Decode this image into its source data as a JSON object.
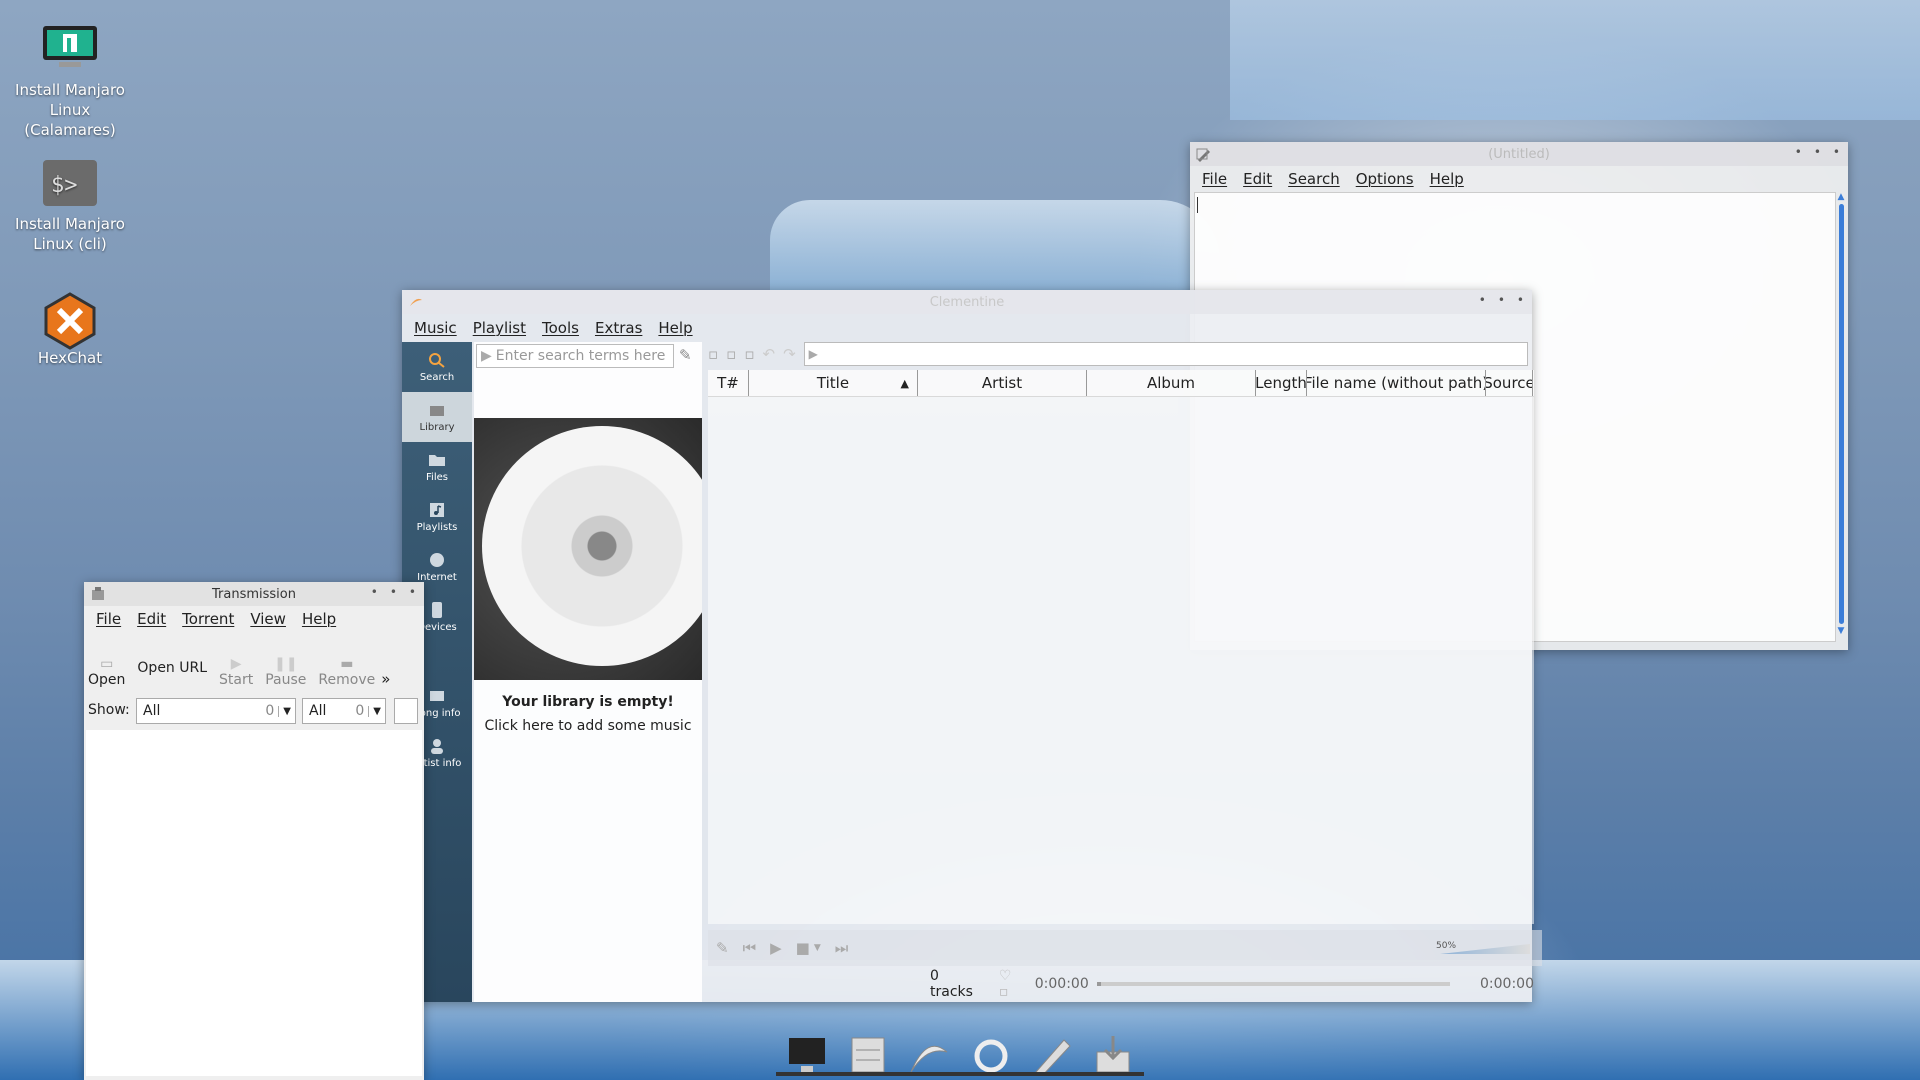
{
  "desktop": {
    "icons": [
      {
        "label_lines": [
          "Install Manjaro",
          "Linux",
          "(Calamares)"
        ],
        "icon": "installer-monitor-icon"
      },
      {
        "label_lines": [
          "Install Manjaro",
          "Linux (cli)"
        ],
        "icon": "terminal-icon"
      },
      {
        "label_lines": [
          "HexChat"
        ],
        "icon": "hexchat-icon"
      }
    ]
  },
  "editor": {
    "title": "(Untitled)",
    "menu": [
      "File",
      "Edit",
      "Search",
      "Options",
      "Help"
    ]
  },
  "clementine": {
    "title": "Clementine",
    "menu": [
      "Music",
      "Playlist",
      "Tools",
      "Extras",
      "Help"
    ],
    "sidebar": [
      "Search",
      "Library",
      "Files",
      "Playlists",
      "Internet",
      "Devices",
      "Song info",
      "Artist info"
    ],
    "search_placeholder": "Enter search terms here",
    "library_empty_title": "Your library is empty!",
    "library_empty_link": "Click here to add some music",
    "columns": [
      "T#",
      "Title",
      "Artist",
      "Album",
      "Length",
      "File name (without path)",
      "Source"
    ],
    "tracks_label": "0 tracks",
    "time_elapsed": "0:00:00",
    "time_total": "0:00:00",
    "volume_label": "50%",
    "volume": 0.5
  },
  "transmission": {
    "title": "Transmission",
    "menu": [
      "File",
      "Edit",
      "Torrent",
      "View",
      "Help"
    ],
    "toolbar": [
      "Open",
      "Open URL",
      "Start",
      "Pause",
      "Remove"
    ],
    "overflow": "»",
    "show_label": "Show:",
    "filter1": {
      "value": "All",
      "count": "0"
    },
    "filter2": {
      "value": "All",
      "count": "0"
    }
  },
  "taskbar": {
    "items": [
      "monitor-icon",
      "file-manager-icon",
      "clementine-icon",
      "update-icon",
      "editor-icon",
      "transmission-icon"
    ]
  }
}
